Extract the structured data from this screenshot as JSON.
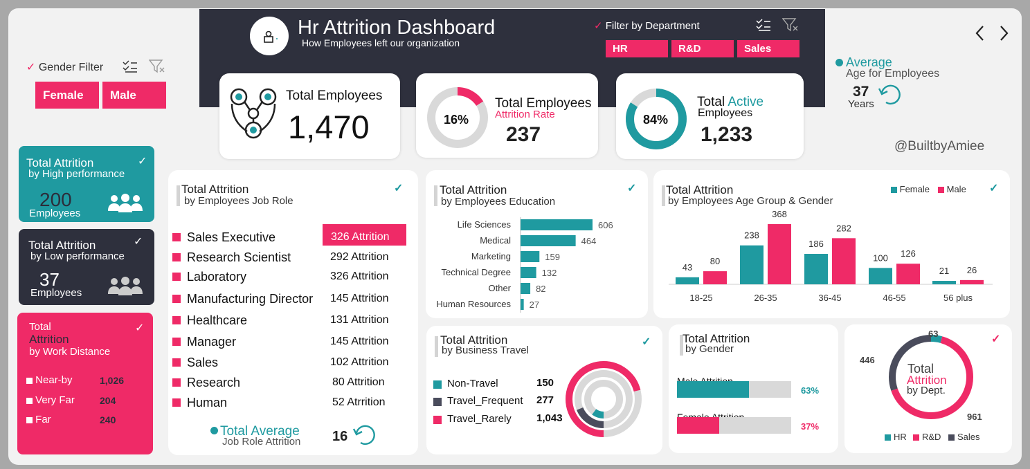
{
  "header": {
    "title": "Hr Attrition Dashboard",
    "subtitle": "How Employees left our organization",
    "dept_filter_label": "Filter by Department",
    "dept_buttons": [
      "HR",
      "R&D",
      "Sales"
    ]
  },
  "gender_filter": {
    "label": "Gender Filter",
    "buttons": [
      "Female",
      "Male"
    ]
  },
  "nav": {
    "prev": "‹",
    "next": "›"
  },
  "kpis": {
    "total_employees": {
      "label": "Total Employees",
      "value": "1,470"
    },
    "attrition": {
      "label": "Total Employees",
      "sublabel": "Attrition Rate",
      "percent": "16%",
      "percent_value": 16,
      "value": "237"
    },
    "active": {
      "label_a": "Total",
      "label_b": "Active",
      "sublabel": "Employees",
      "percent": "84%",
      "percent_value": 84,
      "value": "1,233"
    }
  },
  "average_age": {
    "label": "Average",
    "sublabel": "Age for Employees",
    "value": "37",
    "unit": "Years"
  },
  "credit": "@BuiltbyAmiee",
  "high_perf": {
    "title": "Total Attrition",
    "subtitle": "by High performance",
    "value": "200",
    "unit": "Employees"
  },
  "low_perf": {
    "title": "Total Attrition",
    "subtitle": "by Low performance",
    "value": "37",
    "unit": "Employees"
  },
  "work_distance": {
    "title_a": "Total",
    "title_b": "Attrition",
    "subtitle": "by Work Distance",
    "items": [
      {
        "label": "Near-by",
        "value": "1,026"
      },
      {
        "label": "Very Far",
        "value": "204"
      },
      {
        "label": "Far",
        "value": "240"
      }
    ]
  },
  "job_role": {
    "title": "Total Attrition",
    "subtitle": "by Employees Job Role",
    "rows": [
      {
        "role": "Sales Executive",
        "value": "326 Attrition"
      },
      {
        "role": "Research Scientist",
        "value": "292 Attrition"
      },
      {
        "role": "Laboratory",
        "value": "326 Attrition"
      },
      {
        "role": "Manufacturing Director",
        "value": "145 Attrition"
      },
      {
        "role": "Healthcare",
        "value": "131 Attrition"
      },
      {
        "role": "Manager",
        "value": "145 Attrition"
      },
      {
        "role": "Sales",
        "value": "102 Attrition"
      },
      {
        "role": "Research",
        "value": "80 Attrition"
      },
      {
        "role": "Human",
        "value": "52 Atrrition"
      }
    ],
    "avg_label": "Total Average",
    "avg_sublabel": "Job Role Attrition",
    "avg_value": "16"
  },
  "chart_data": [
    {
      "type": "bar",
      "orientation": "horizontal",
      "title": "Total Attrition",
      "subtitle": "by Employees Education",
      "categories": [
        "Life Sciences",
        "Medical",
        "Marketing",
        "Technical Degree",
        "Other",
        "Human Resources"
      ],
      "values": [
        606,
        464,
        159,
        132,
        82,
        27
      ],
      "color": "#1f9aa0"
    },
    {
      "type": "bar",
      "title": "Total Attrition",
      "subtitle": "by Employees Age Group & Gender",
      "categories": [
        "18-25",
        "26-35",
        "36-45",
        "46-55",
        "56 plus"
      ],
      "series": [
        {
          "name": "Female",
          "values": [
            43,
            238,
            186,
            100,
            21
          ],
          "color": "#1f9aa0"
        },
        {
          "name": "Male",
          "values": [
            80,
            368,
            282,
            126,
            26
          ],
          "color": "#ef2a67"
        }
      ],
      "legend": "top-right"
    },
    {
      "type": "pie",
      "variant": "radial",
      "title": "Total Attrition",
      "subtitle": "by Business Travel",
      "categories": [
        "Non-Travel",
        "Travel_Frequent",
        "Travel_Rarely"
      ],
      "values": [
        150,
        277,
        1043
      ],
      "labels": [
        "150",
        "277",
        "1,043"
      ],
      "colors": [
        "#1f9aa0",
        "#4a4c5c",
        "#ef2a67"
      ]
    },
    {
      "type": "bar",
      "orientation": "horizontal",
      "title": "Total Attrition",
      "subtitle": "by Gender",
      "categories": [
        "Male Attrition",
        "Female Attrition"
      ],
      "values": [
        63,
        37
      ],
      "labels": [
        "63%",
        "37%"
      ],
      "colors": [
        "#1f9aa0",
        "#ef2a67"
      ],
      "xlim": [
        0,
        100
      ]
    },
    {
      "type": "pie",
      "variant": "donut",
      "center_a": "Total",
      "center_b": "Attrition",
      "center_c": "by Dept.",
      "categories": [
        "HR",
        "R&D",
        "Sales"
      ],
      "values": [
        63,
        961,
        446
      ],
      "labels": [
        "63",
        "961",
        "446"
      ],
      "colors": [
        "#1f9aa0",
        "#ef2a67",
        "#4a4c5c"
      ],
      "legend": "bottom"
    }
  ],
  "colors": {
    "teal": "#1f9aa0",
    "pink": "#ef2a67",
    "dark": "#2b2d3a"
  }
}
